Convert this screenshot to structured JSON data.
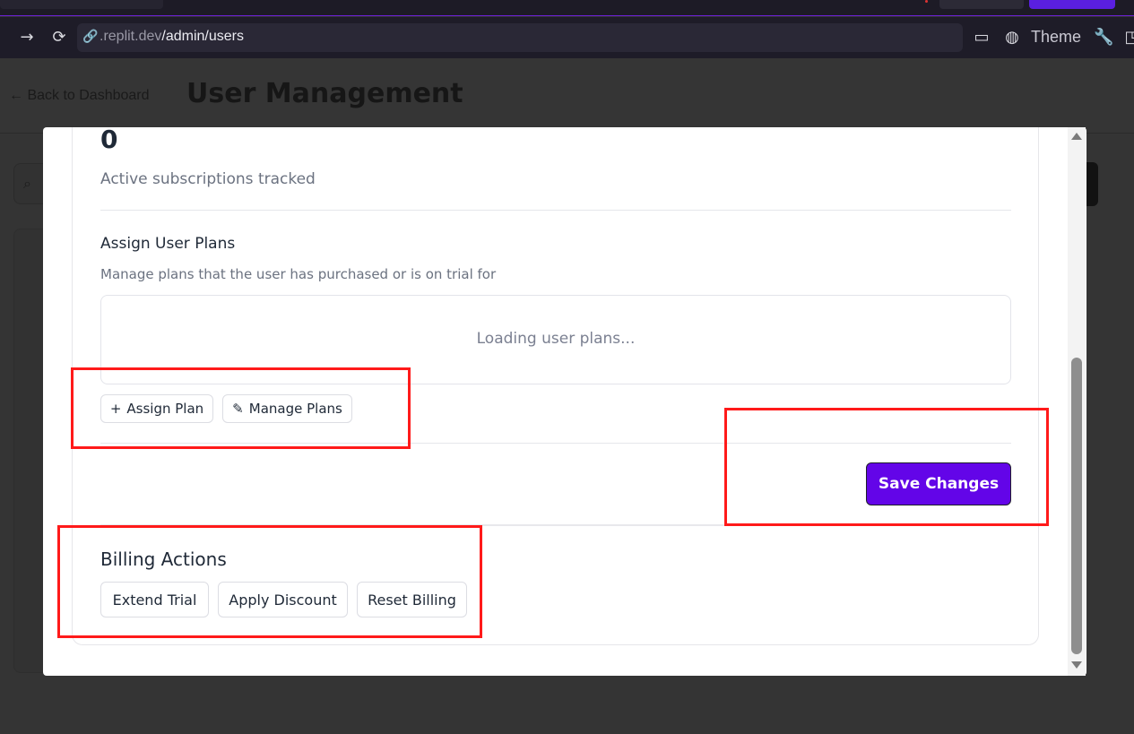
{
  "browser": {
    "url_domain": ".replit.dev",
    "url_path": "/admin/users",
    "theme_label": "Theme"
  },
  "page": {
    "back_link": "← Back to Dashboard",
    "title": "User Management"
  },
  "modal": {
    "stat_value": "0",
    "stat_description": "Active subscriptions tracked",
    "assign_plans": {
      "title": "Assign User Plans",
      "subtitle": "Manage plans that the user has purchased or is on trial for",
      "loading_text": "Loading user plans...",
      "assign_plan_label": "Assign Plan",
      "manage_plans_label": "Manage Plans"
    },
    "save_label": "Save Changes",
    "billing": {
      "title": "Billing Actions",
      "extend_trial_label": "Extend Trial",
      "apply_discount_label": "Apply Discount",
      "reset_billing_label": "Reset Billing"
    }
  },
  "colors": {
    "primary": "#6305e8",
    "annotation": "#ff1a1a"
  }
}
